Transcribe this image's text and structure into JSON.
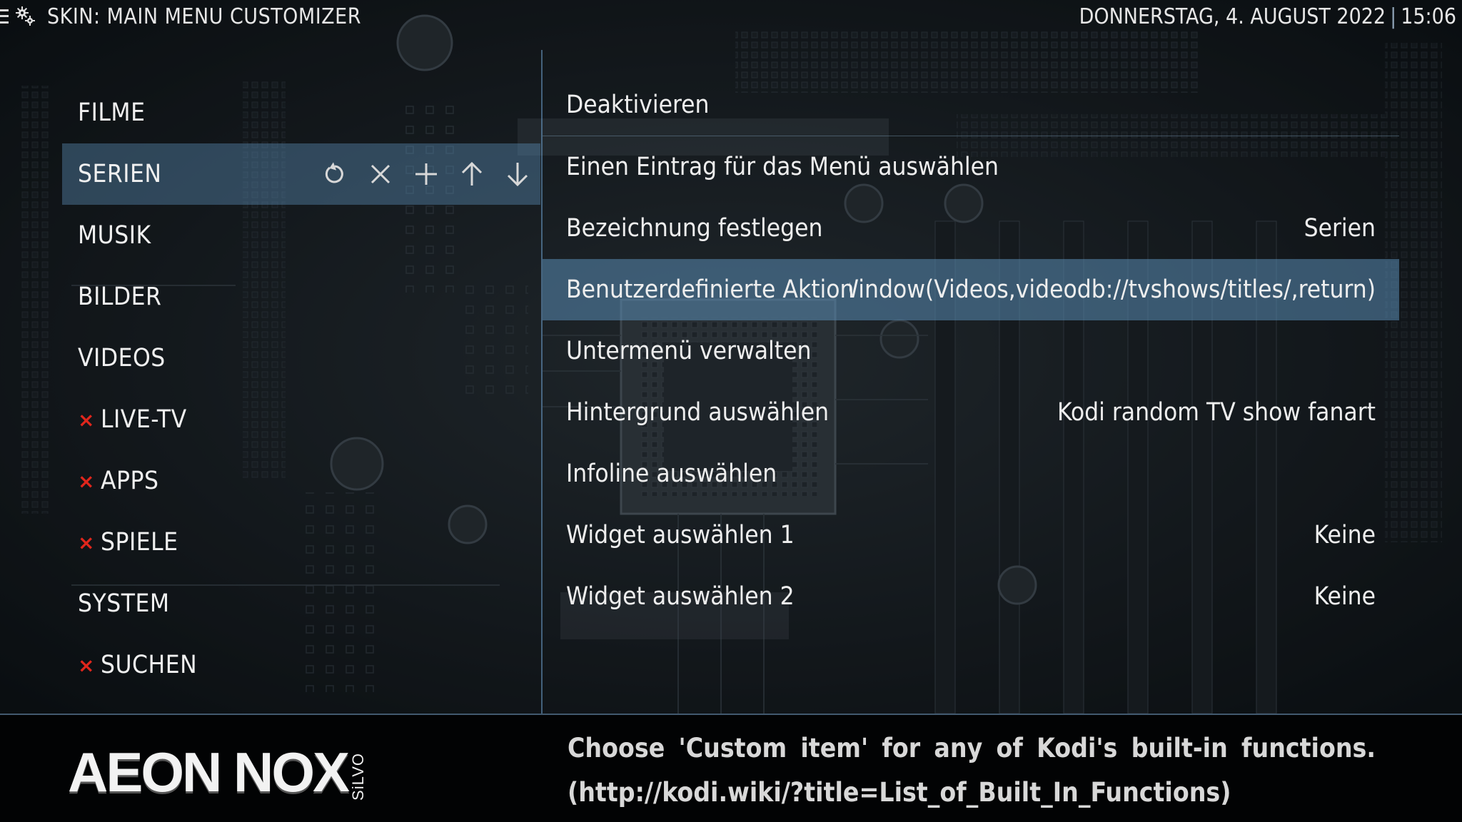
{
  "header": {
    "window_title": "SKIN: MAIN MENU CUSTOMIZER",
    "date": "DONNERSTAG, 4. AUGUST 2022",
    "time": "15:06"
  },
  "left_menu": {
    "items": [
      {
        "label": "FILME",
        "disabled": false
      },
      {
        "label": "SERIEN",
        "disabled": false,
        "selected": true
      },
      {
        "label": "MUSIK",
        "disabled": false
      },
      {
        "label": "BILDER",
        "disabled": false
      },
      {
        "label": "VIDEOS",
        "disabled": false
      },
      {
        "label": "LIVE-TV",
        "disabled": true
      },
      {
        "label": "APPS",
        "disabled": true
      },
      {
        "label": "SPIELE",
        "disabled": true
      },
      {
        "label": "SYSTEM",
        "disabled": false
      },
      {
        "label": "SUCHEN",
        "disabled": true
      }
    ],
    "disabled_marker": "×",
    "tools": [
      "reset-icon",
      "delete-icon",
      "add-icon",
      "move-up-icon",
      "move-down-icon"
    ]
  },
  "options": [
    {
      "label": "Deaktivieren",
      "value": ""
    },
    {
      "label": "Einen Eintrag für das Menü auswählen",
      "value": ""
    },
    {
      "label": "Bezeichnung festlegen",
      "value": "Serien"
    },
    {
      "label": "Benutzerdefinierte Aktion",
      "value": "ActivateWindow(Videos,videodb://tvshows/titles/,return)",
      "selected": true
    },
    {
      "label": "Untermenü verwalten",
      "value": ""
    },
    {
      "label": "Hintergrund auswählen",
      "value": "Kodi random TV show fanart"
    },
    {
      "label": "Infoline auswählen",
      "value": ""
    },
    {
      "label": "Widget auswählen 1",
      "value": "Keine"
    },
    {
      "label": "Widget auswählen 2",
      "value": "Keine"
    }
  ],
  "footer": {
    "logo_text": "AEON NOX",
    "logo_sub": "SiLVO",
    "help_line1": "Choose 'Custom item' for any of Kodi's built-in functions.",
    "help_line2": "(http://kodi.wiki/?title=List_of_Built_In_Functions)"
  },
  "colors": {
    "accent": "#5a8cb4",
    "disabled_marker": "#e0261c",
    "divider": "#6ea0cd"
  }
}
